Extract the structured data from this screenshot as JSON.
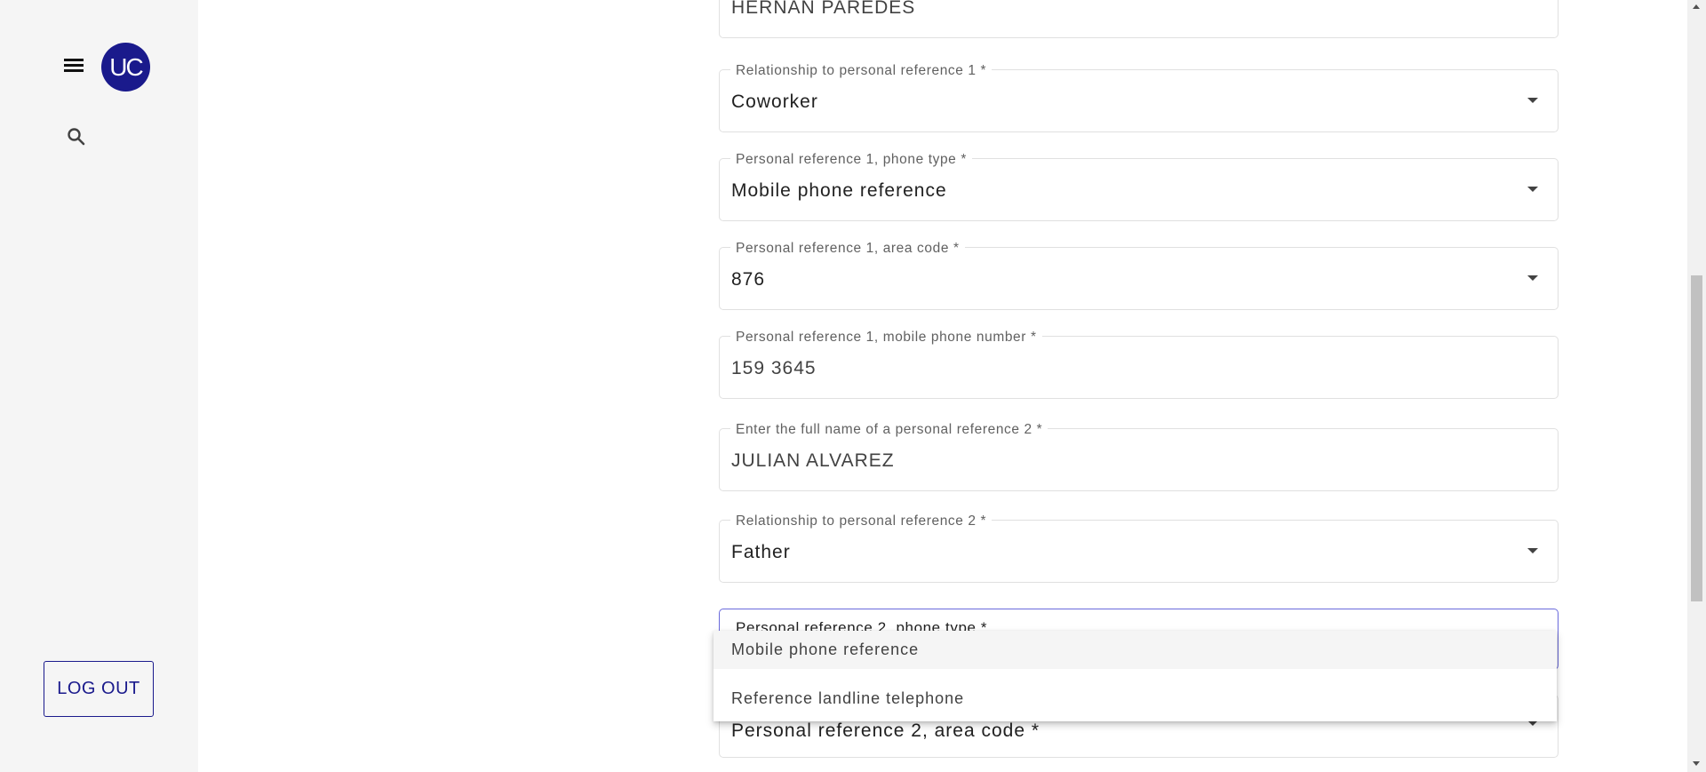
{
  "sidebar": {
    "avatar_initials": "UC",
    "menu_icon": "menu-icon",
    "search_icon": "search-icon",
    "logout_label": "LOG OUT"
  },
  "form": {
    "ref1_name": {
      "value": "HERNAN PAREDES"
    },
    "ref1_relationship": {
      "label": "Relationship to personal reference 1 *",
      "value": "Coworker"
    },
    "ref1_phone_type": {
      "label": "Personal reference 1, phone type *",
      "value": "Mobile phone reference"
    },
    "ref1_area_code": {
      "label": "Personal reference 1, area code *",
      "value": "876"
    },
    "ref1_mobile": {
      "label": "Personal reference 1, mobile phone number *",
      "value": "159 3645"
    },
    "ref2_name": {
      "label": "Enter the full name of a personal reference 2 *",
      "value": "JULIAN ALVAREZ"
    },
    "ref2_relationship": {
      "label": "Relationship to personal reference 2 *",
      "value": "Father"
    },
    "ref2_phone_type": {
      "label": "Personal reference 2, phone type *"
    },
    "ref2_area_code": {
      "placeholder": "Personal reference 2, area code *"
    }
  },
  "dropdown": {
    "options": [
      "Mobile phone reference",
      "Reference landline telephone"
    ],
    "selected": "Mobile phone reference"
  },
  "colors": {
    "brand": "#1a1a8c",
    "focus_border": "#6a6adc"
  }
}
